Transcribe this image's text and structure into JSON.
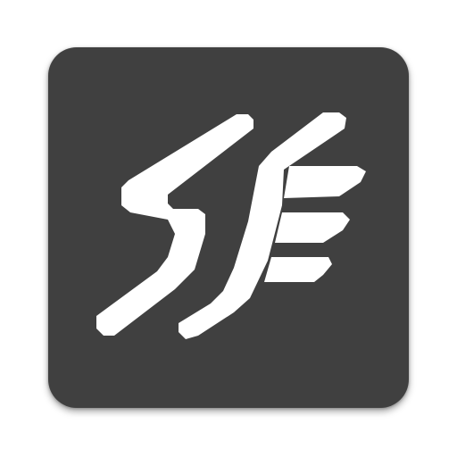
{
  "app_icon": {
    "background_color": "#404040",
    "glyph_color": "#ffffff",
    "glyph": "logo-mark"
  }
}
